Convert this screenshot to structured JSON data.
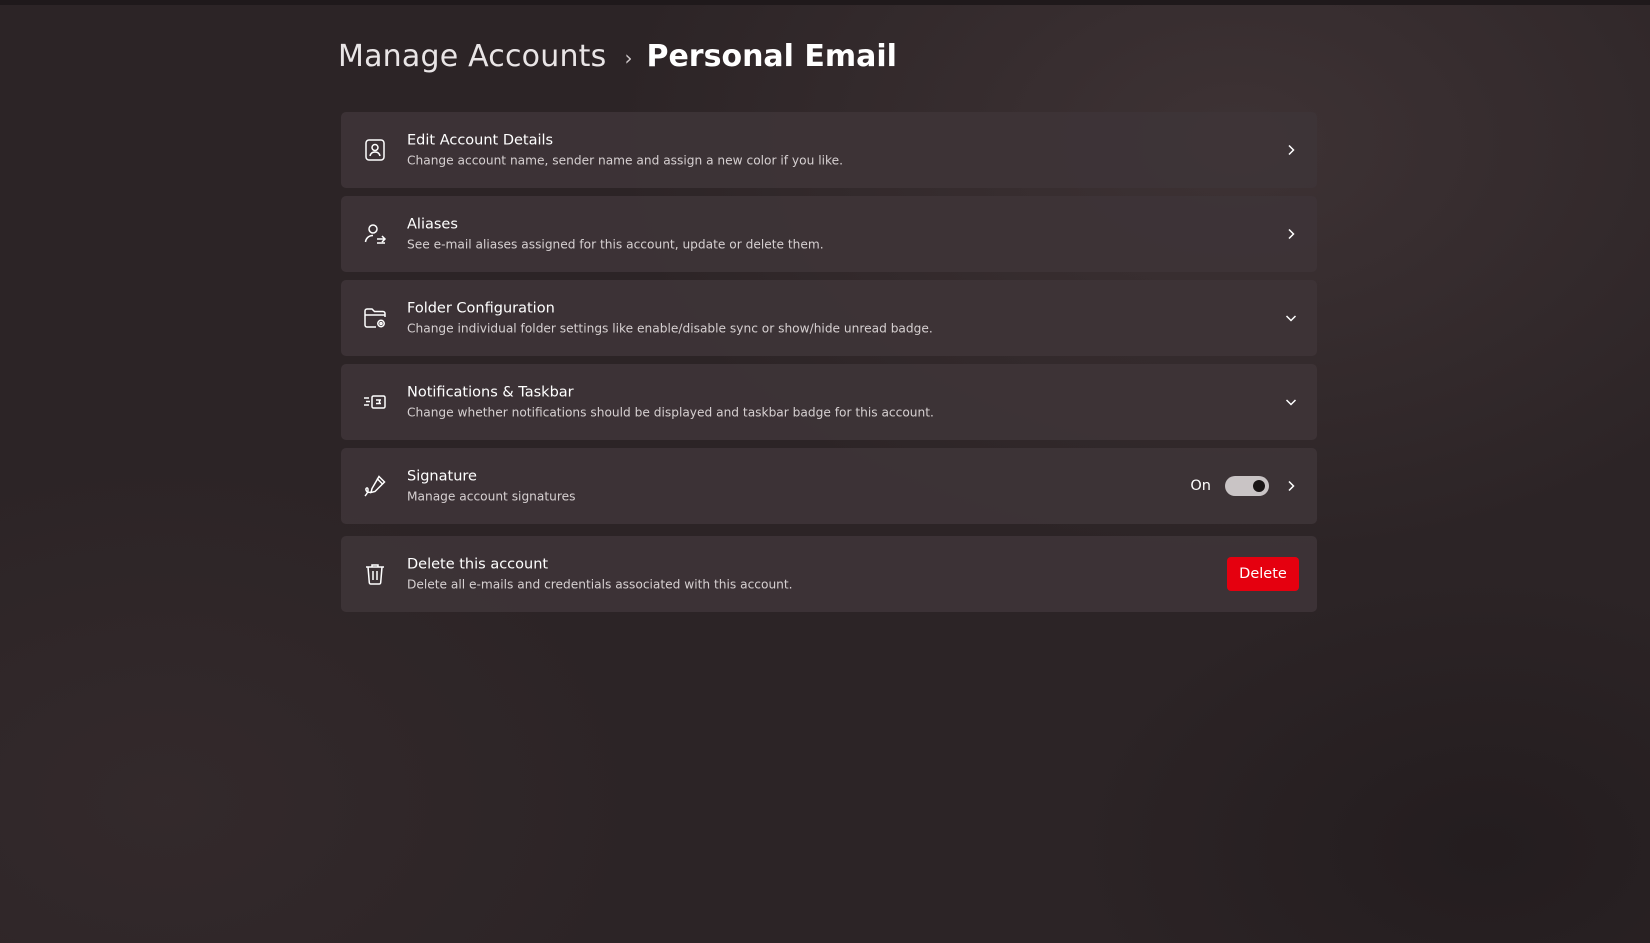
{
  "breadcrumb": {
    "parent": "Manage Accounts",
    "separator": "›",
    "current": "Personal Email"
  },
  "settings": [
    {
      "icon": "account-details-icon",
      "title": "Edit Account Details",
      "description": "Change account name, sender name and assign a new color if you like.",
      "trailing": "chevron-right-icon"
    },
    {
      "icon": "aliases-icon",
      "title": "Aliases",
      "description": "See e-mail aliases assigned for this account, update or delete them.",
      "trailing": "chevron-right-icon"
    },
    {
      "icon": "folder-settings-icon",
      "title": "Folder Configuration",
      "description": "Change individual folder settings like enable/disable sync or show/hide unread badge.",
      "trailing": "chevron-down-icon"
    },
    {
      "icon": "notifications-icon",
      "title": "Notifications & Taskbar",
      "description": "Change whether notifications should be displayed and taskbar badge for this account.",
      "trailing": "chevron-down-icon"
    },
    {
      "icon": "signature-icon",
      "title": "Signature",
      "description": "Manage account signatures",
      "toggle_label": "On",
      "toggle_on": true,
      "trailing": "chevron-right-icon"
    },
    {
      "icon": "trash-icon",
      "title": "Delete this account",
      "description": "Delete all e-mails and credentials associated with this account.",
      "button_label": "Delete"
    }
  ],
  "colors": {
    "background": "#2c2426",
    "card": "#3e3437",
    "delete_button": "#e5000f",
    "toggle_track": "#c9c4c5"
  }
}
